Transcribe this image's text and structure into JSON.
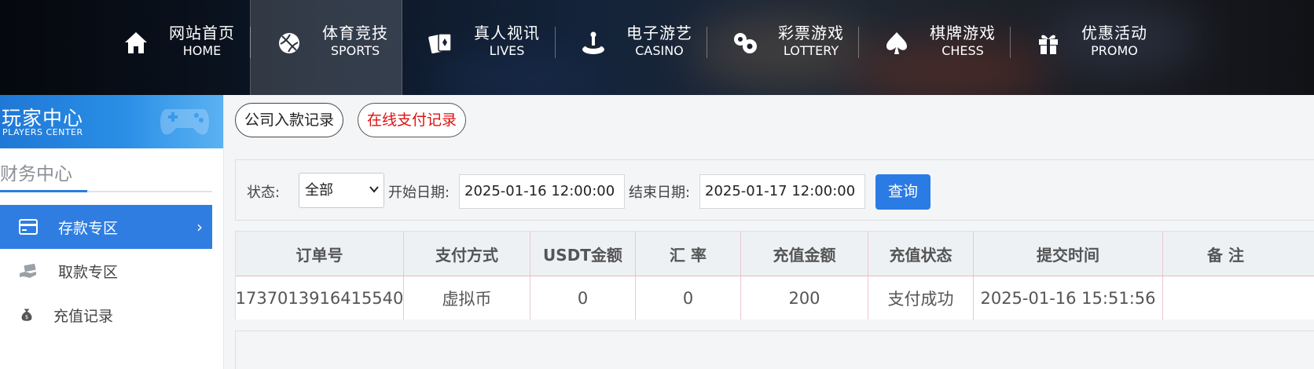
{
  "nav": {
    "items": [
      {
        "cn": "网站首页",
        "en": "HOME",
        "icon": "home-icon"
      },
      {
        "cn": "体育竞技",
        "en": "SPORTS",
        "icon": "sports-ball-icon",
        "active": true
      },
      {
        "cn": "真人视讯",
        "en": "LIVES",
        "icon": "playing-cards-icon"
      },
      {
        "cn": "电子游艺",
        "en": "CASINO",
        "icon": "slot-machine-icon"
      },
      {
        "cn": "彩票游戏",
        "en": "LOTTERY",
        "icon": "lottery-balls-icon"
      },
      {
        "cn": "棋牌游戏",
        "en": "CHESS",
        "icon": "spade-icon"
      },
      {
        "cn": "优惠活动",
        "en": "PROMO",
        "icon": "gift-icon"
      }
    ]
  },
  "sidebar": {
    "banner_title": "玩家中心",
    "banner_sub": "PLAYERS CENTER",
    "section_title": "财务中心",
    "items": [
      {
        "label": "存款专区",
        "icon": "card-icon",
        "active": true
      },
      {
        "label": "取款专区",
        "icon": "hand-money-icon"
      },
      {
        "label": "充值记录",
        "icon": "money-bag-icon"
      }
    ]
  },
  "tabs": {
    "company_deposit": "公司入款记录",
    "online_payment": "在线支付记录"
  },
  "filter": {
    "status_label": "状态:",
    "status_value": "全部",
    "start_label": "开始日期:",
    "start_value": "2025-01-16 12:00:00",
    "end_label": "结束日期:",
    "end_value": "2025-01-17 12:00:00",
    "query_button": "查询"
  },
  "table": {
    "headers": [
      "订单号",
      "支付方式",
      "USDT金额",
      "汇 率",
      "充值金额",
      "充值状态",
      "提交时间",
      "备 注"
    ],
    "rows": [
      [
        "1737013916415540",
        "虚拟币",
        "0",
        "0",
        "200",
        "支付成功",
        "2025-01-16 15:51:56",
        ""
      ]
    ]
  },
  "colors": {
    "accent": "#2b7be4",
    "online_payment_text": "#e01010",
    "sidebar_active": "#2f7de1"
  }
}
